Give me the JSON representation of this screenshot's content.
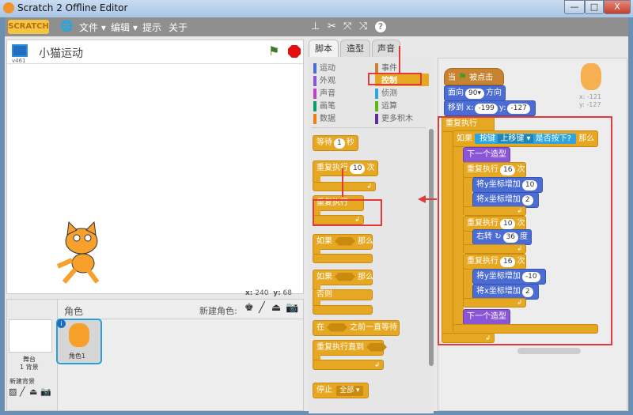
{
  "window": {
    "title": "Scratch 2 Offline Editor",
    "controls": [
      "—",
      "□",
      "X"
    ]
  },
  "menubar": {
    "logo": "SCRATCH",
    "items": [
      "文件 ▾",
      "编辑 ▾",
      "提示",
      "关于"
    ],
    "tool_icons": [
      "duplicate-stamp-icon",
      "cut-icon",
      "grow-icon",
      "shrink-icon",
      "help-icon"
    ]
  },
  "stage": {
    "project_title": "小猫运动",
    "version": "v461",
    "coords": {
      "x_label": "x:",
      "x": "240",
      "y_label": "y:",
      "y": "68"
    }
  },
  "tabs": [
    "脚本",
    "造型",
    "声音"
  ],
  "categories": {
    "left": [
      {
        "label": "运动",
        "color": "#4a6cd4"
      },
      {
        "label": "外观",
        "color": "#8a55d7"
      },
      {
        "label": "声音",
        "color": "#bb42c3"
      },
      {
        "label": "画笔",
        "color": "#0e9a6c"
      },
      {
        "label": "数据",
        "color": "#ee7d16"
      }
    ],
    "right": [
      {
        "label": "事件",
        "color": "#c88330"
      },
      {
        "label": "控制",
        "color": "#e6a822",
        "selected": true
      },
      {
        "label": "侦测",
        "color": "#2ca5e2"
      },
      {
        "label": "运算",
        "color": "#5cb712"
      },
      {
        "label": "更多积木",
        "color": "#632d99"
      }
    ]
  },
  "palette": {
    "wait": "等待",
    "wait_val": "1",
    "sec": "秒",
    "repeat": "重复执行",
    "repeat_val": "10",
    "times": "次",
    "forever": "重复执行",
    "if": "如果",
    "then": "那么",
    "else": "否则",
    "wait_until": "在",
    "wait_until2": "之前一直等待",
    "repeat_until": "重复执行直到",
    "stop": "停止",
    "stop_val": "全部 ▾"
  },
  "script": {
    "hat": "当",
    "hat2": "被点击",
    "point": "面向",
    "point_val": "90▾",
    "direction": "方向",
    "goto": "移到 x:",
    "goto_x": "-199",
    "goto_y_label": "y:",
    "goto_y": "-127",
    "forever": "重复执行",
    "if": "如果",
    "key": "按键",
    "key_val": "上移键 ▾",
    "pressed": "是否按下?",
    "then": "那么",
    "next_costume": "下一个造型",
    "repeat": "重复执行",
    "times": "次",
    "r1": "16",
    "change_y": "将y坐标增加",
    "cy1": "10",
    "change_x": "将x坐标增加",
    "cx1": "2",
    "r2": "10",
    "turn": "右转",
    "turn_val": "36",
    "deg": "度",
    "r3": "16",
    "cy2": "-10",
    "cx2": "2"
  },
  "sprite_info": {
    "x": "x: -121",
    "y": "y: -127"
  },
  "sprites_panel": {
    "header": "角色",
    "new_sprite": "新建角色:",
    "stage_label": "舞台",
    "backdrops": "1 背景",
    "new_backdrop": "新建背景",
    "sprite_name": "角色1"
  },
  "colors": {
    "control": "#e6a822",
    "motion": "#4a6cd4",
    "looks": "#8a55d7",
    "sensing": "#2ca5e2",
    "highlight": "#e23a3a"
  }
}
